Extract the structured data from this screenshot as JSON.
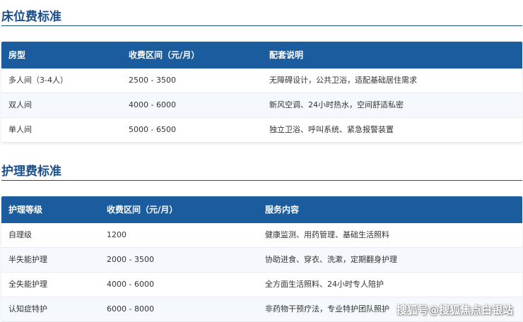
{
  "bed_section": {
    "title": "床位费标准",
    "headers": [
      "房型",
      "收费区间（元/月）",
      "配套说明"
    ],
    "rows": [
      [
        "多人间（3-4人）",
        "2500 - 3500",
        "无障碍设计，公共卫浴，适配基础居住需求"
      ],
      [
        "双人间",
        "4000 - 6000",
        "新风空调、24小时热水，空间舒适私密"
      ],
      [
        "单人间",
        "5000 - 6500",
        "独立卫浴、呼叫系统、紧急报警装置"
      ]
    ]
  },
  "care_section": {
    "title": "护理费标准",
    "headers": [
      "护理等级",
      "收费区间（元/月）",
      "服务内容"
    ],
    "rows": [
      [
        "自理级",
        "1200",
        "健康监测、用药管理、基础生活照料"
      ],
      [
        "半失能护理",
        "2000 - 3500",
        "协助进食、穿衣、洗漱，定期翻身护理"
      ],
      [
        "全失能护理",
        "4000 - 6000",
        "全方面生活照料、24小时专人陪护"
      ],
      [
        "认知症特护",
        "6000 - 8000",
        "非药物干预疗法，专业特护团队照护"
      ]
    ]
  },
  "watermark": "搜狐号@搜狐焦点白银站",
  "colors": {
    "accent": "#1b4f8a",
    "header_bg": "#1b5c9e",
    "alt_row_bg": "#f5f8fc"
  }
}
